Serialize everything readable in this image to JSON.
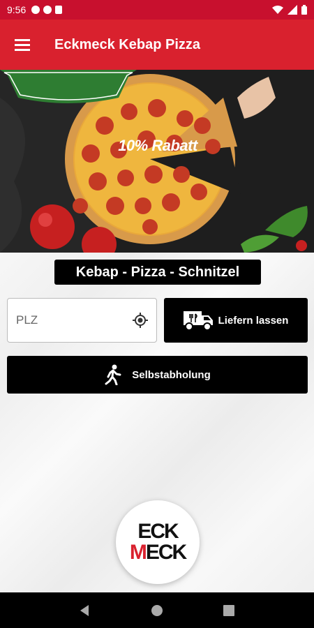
{
  "status_bar": {
    "time": "9:56"
  },
  "app_bar": {
    "title": "Eckmeck Kebap Pizza",
    "menu_icon": "hamburger-menu-icon"
  },
  "hero": {
    "promo_banner": "10% Rabatt"
  },
  "main": {
    "tagline": "Kebap - Pizza - Schnitzel",
    "plz": {
      "placeholder": "PLZ",
      "value": ""
    },
    "delivery_button": {
      "label": "Liefern lassen",
      "icon": "delivery-truck-icon"
    },
    "pickup_button": {
      "label": "Selbstabholung",
      "icon": "walking-person-icon"
    },
    "logo": {
      "line1": "ECK",
      "line2_m": "M",
      "line2_rest": "ECK"
    }
  },
  "colors": {
    "primary": "#d9212e",
    "status": "#c8102e",
    "button": "#000000",
    "banner_green": "#2e7d32"
  }
}
